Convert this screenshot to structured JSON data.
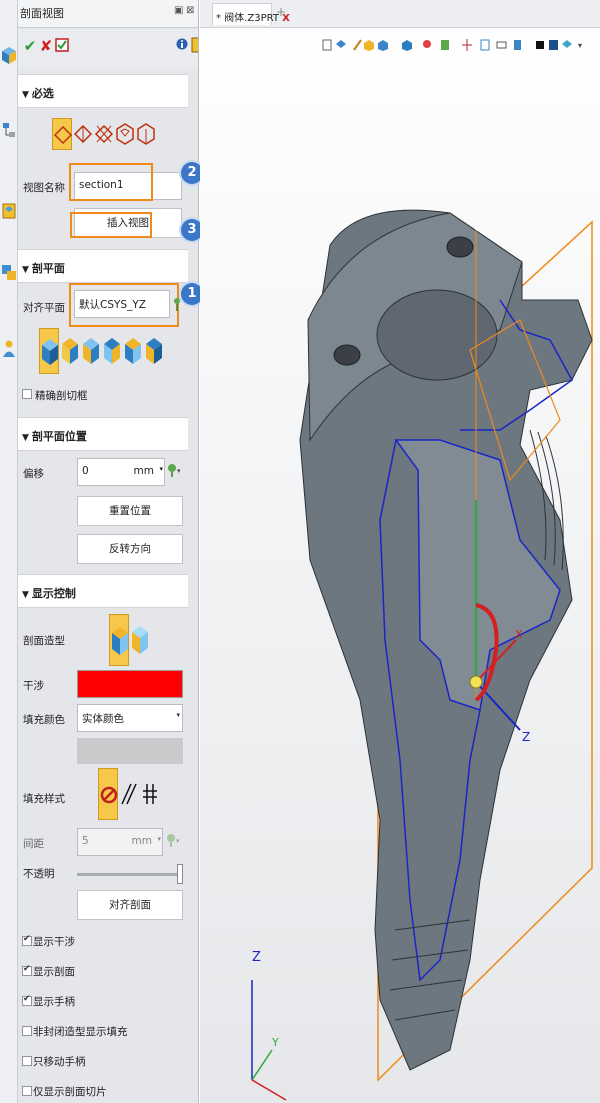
{
  "panel": {
    "title": "剖面视图",
    "pin": "▣",
    "close": "⊠"
  },
  "sections": {
    "required": "必选",
    "cut_plane": "剖平面",
    "cut_position": "剖平面位置",
    "display": "显示控制"
  },
  "fields": {
    "view_name_label": "视图名称",
    "view_name_value": "section1",
    "insert_view": "插入视图",
    "align_plane_label": "对齐平面",
    "align_plane_value": "默认CSYS_YZ",
    "precise_cut": "精确剖切框",
    "offset_label": "偏移",
    "offset_value": "0",
    "offset_unit": "mm",
    "reset_position": "重置位置",
    "reverse_direction": "反转方向",
    "section_shape_label": "剖面造型",
    "interference_label": "干涉",
    "interference_color": "#ff0000",
    "fill_color_label": "填充颜色",
    "fill_color_value": "实体颜色",
    "fill_style_label": "填充样式",
    "spacing_label": "间距",
    "spacing_value": "5",
    "spacing_unit": "mm",
    "opacity_label": "不透明",
    "opacity_level": 1.0,
    "align_section": "对齐剖面"
  },
  "badges": [
    "2",
    "3",
    "1"
  ],
  "checkboxes": [
    {
      "label": "显示干涉",
      "checked": true
    },
    {
      "label": "显示剖面",
      "checked": true
    },
    {
      "label": "显示手柄",
      "checked": true
    },
    {
      "label": "非封闭造型显示填充",
      "checked": false
    },
    {
      "label": "只移动手柄",
      "checked": false
    },
    {
      "label": "仅显示剖面切片",
      "checked": false
    }
  ],
  "viewport": {
    "tab_title": "* 阀体.Z3PRT",
    "tab_close": "X",
    "tab_add": "+",
    "axis_labels": {
      "x": "X",
      "y": "Y",
      "z": "Z"
    }
  },
  "colors": {
    "accent_orange": "#ef8b1a",
    "badge_blue": "#3c76c7",
    "part_gray": "#6d7780",
    "edge_blue": "#1a26c8"
  }
}
